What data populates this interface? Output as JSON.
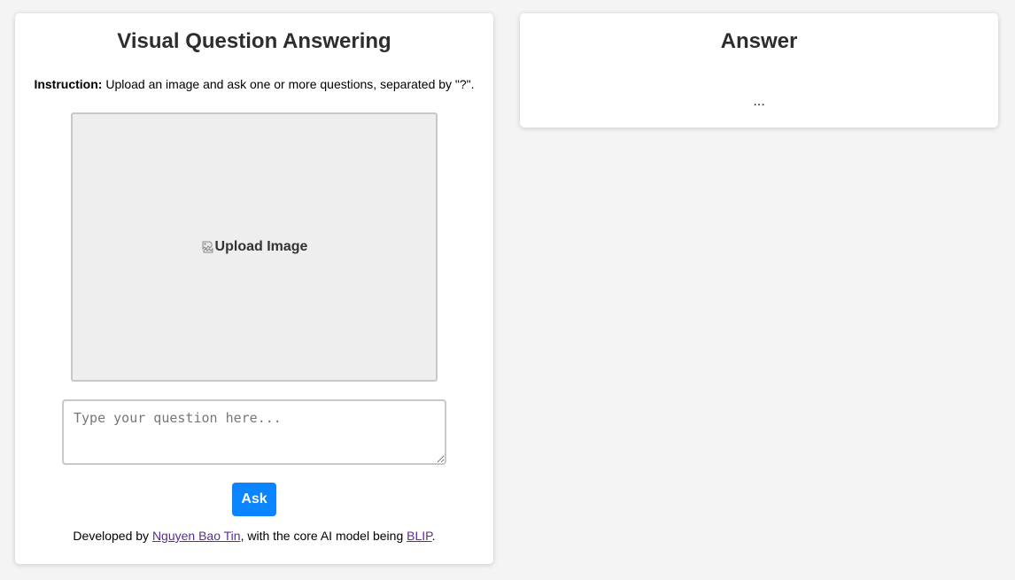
{
  "left_panel": {
    "title": "Visual Question Answering",
    "instruction": {
      "label": "Instruction:",
      "text": " Upload an image and ask one or more questions, separated by \"?\"."
    },
    "upload": {
      "label": "Upload Image",
      "icon": "broken-image-icon"
    },
    "question": {
      "value": "",
      "placeholder": "Type your question here..."
    },
    "ask_label": "Ask",
    "footer": {
      "prefix": "Developed by ",
      "author_link": "Nguyen Bao Tin",
      "middle": ", with the core AI model being ",
      "model_link": "BLIP",
      "suffix": "."
    }
  },
  "right_panel": {
    "title": "Answer",
    "answer": "..."
  },
  "colors": {
    "background": "#f4f4f4",
    "panel": "#ffffff",
    "accent": "#0a84ff",
    "link": "#5b2c91"
  }
}
